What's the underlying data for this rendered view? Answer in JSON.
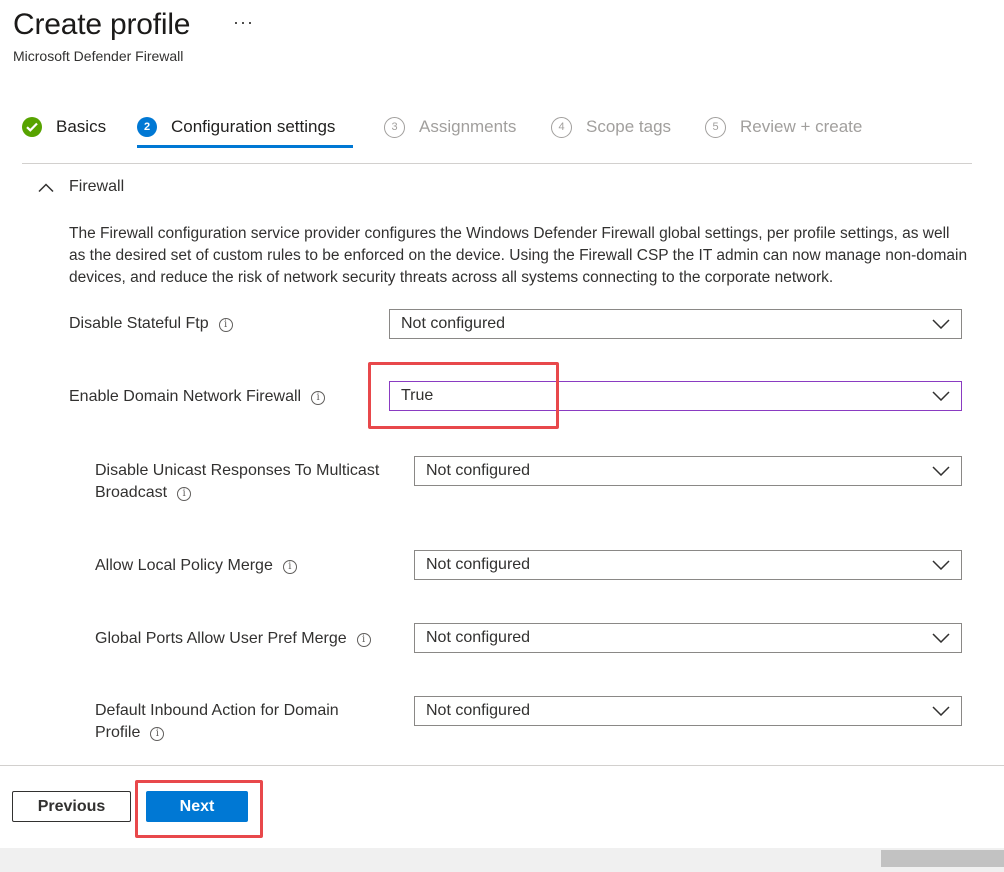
{
  "header": {
    "title": "Create profile",
    "more": "···",
    "subtitle": "Microsoft Defender Firewall"
  },
  "wizard": {
    "steps": [
      {
        "number": "",
        "label": "Basics",
        "state": "completed",
        "icon": "checkmark-icon"
      },
      {
        "number": "2",
        "label": "Configuration settings",
        "state": "current"
      },
      {
        "number": "3",
        "label": "Assignments",
        "state": "upcoming"
      },
      {
        "number": "4",
        "label": "Scope tags",
        "state": "upcoming"
      },
      {
        "number": "5",
        "label": "Review + create",
        "state": "upcoming"
      }
    ]
  },
  "section": {
    "title": "Firewall",
    "expanded": true,
    "collapse_icon": "chevron-up-icon",
    "description": "The Firewall configuration service provider configures the Windows Defender Firewall global settings, per profile settings, as well as the desired set of custom rules to be enforced on the device. Using the Firewall CSP the IT admin can now manage non-domain devices, and reduce the risk of network security threats across all systems connecting to the corporate network."
  },
  "settings": [
    {
      "label": "Disable Stateful Ftp",
      "value": "Not configured"
    },
    {
      "label": "Enable Domain Network Firewall",
      "value": "True"
    },
    {
      "label": "Disable Unicast Responses To Multicast Broadcast",
      "value": "Not configured"
    },
    {
      "label": "Allow Local Policy Merge",
      "value": "Not configured"
    },
    {
      "label": "Global Ports Allow User Pref Merge",
      "value": "Not configured"
    },
    {
      "label": "Default Inbound Action for Domain Profile",
      "value": "Not configured"
    }
  ],
  "footer": {
    "previous_label": "Previous",
    "next_label": "Next"
  },
  "icons": {
    "info": "info-icon",
    "dropdown": "chevron-down-icon"
  },
  "colors": {
    "accent": "#0078d4",
    "success": "#57a300",
    "focus_border": "#8a3bc2",
    "annotation": "#e8484b"
  }
}
